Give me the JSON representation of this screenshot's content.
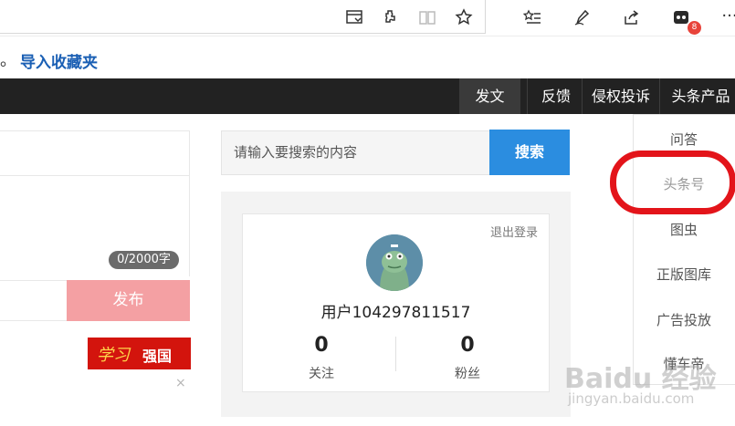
{
  "browser": {
    "extension_badge": "8",
    "toolbar_icons": [
      "reading-view-icon",
      "extensions-icon",
      "book-icon",
      "favorite-star-icon",
      "favorites-list-icon",
      "pen-icon",
      "share-icon",
      "extension-app-icon",
      "more-icon"
    ],
    "more_label": "···"
  },
  "favorites_bar": {
    "dot": "。",
    "import_label": "导入收藏夹"
  },
  "site_nav": {
    "items": [
      {
        "label": "发文",
        "active": true
      },
      {
        "label": "反馈",
        "active": false
      },
      {
        "label": "侵权投诉",
        "active": false
      },
      {
        "label": "头条产品",
        "active": false
      }
    ]
  },
  "editor": {
    "char_count": "0/2000字",
    "publish_label": "发布"
  },
  "banner": {
    "script": "学习",
    "text": "强国",
    "close": "×"
  },
  "search": {
    "placeholder": "请输入要搜索的内容",
    "button_label": "搜索"
  },
  "user_card": {
    "logout": "退出登录",
    "username": "用户104297811517",
    "following_count": "0",
    "following_label": "关注",
    "followers_count": "0",
    "followers_label": "粉丝"
  },
  "dropdown": {
    "items": [
      {
        "label": "问答"
      },
      {
        "label": "头条号",
        "highlighted": true
      },
      {
        "label": "图虫"
      },
      {
        "label": "正版图库"
      },
      {
        "label": "广告投放"
      },
      {
        "label": "懂车帝"
      }
    ]
  },
  "watermark": {
    "brand": "Baidu 经验",
    "url": "jingyan.baidu.com"
  },
  "colors": {
    "nav_bg": "#222222",
    "search_button": "#2b8de0",
    "publish_button": "#f4a0a3",
    "highlight_ring": "#e3141a",
    "badge": "#e8433a"
  }
}
